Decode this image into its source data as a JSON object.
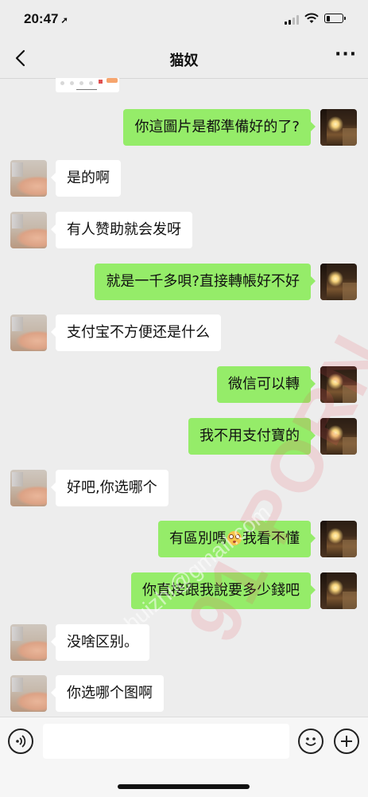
{
  "status_bar": {
    "time": "20:47",
    "location_glyph": "➚",
    "battery_percent": 25
  },
  "header": {
    "title": "猫奴",
    "back_icon": "chevron-left-icon",
    "more_icon": "more-dots-icon"
  },
  "messages": [
    {
      "side": "out",
      "text": "你這圖片是都準備好的了?"
    },
    {
      "side": "in",
      "text": "是的啊"
    },
    {
      "side": "in",
      "text": "有人赞助就会发呀"
    },
    {
      "side": "out",
      "text": "就是一千多唄?直接轉帳好不好"
    },
    {
      "side": "in",
      "text": "支付宝不方便还是什么"
    },
    {
      "side": "out",
      "text": "微信可以轉"
    },
    {
      "side": "out",
      "text": "我不用支付寶的"
    },
    {
      "side": "in",
      "text": "好吧,你选哪个"
    },
    {
      "side": "out",
      "text_before": "有區別嗎",
      "emoji": "flushed-face-icon",
      "text_after": "我看不懂"
    },
    {
      "side": "out",
      "text": "你直接跟我說要多少錢吧"
    },
    {
      "side": "in",
      "text": "没啥区别。"
    },
    {
      "side": "in",
      "text": "你选哪个图啊"
    }
  ],
  "watermark": {
    "brand": "91 PORN",
    "email": "shuizhi@gmail.com"
  },
  "composer": {
    "value": "",
    "voice_icon": "voice-icon",
    "emoji_icon": "smiley-icon",
    "plus_icon": "plus-icon"
  }
}
